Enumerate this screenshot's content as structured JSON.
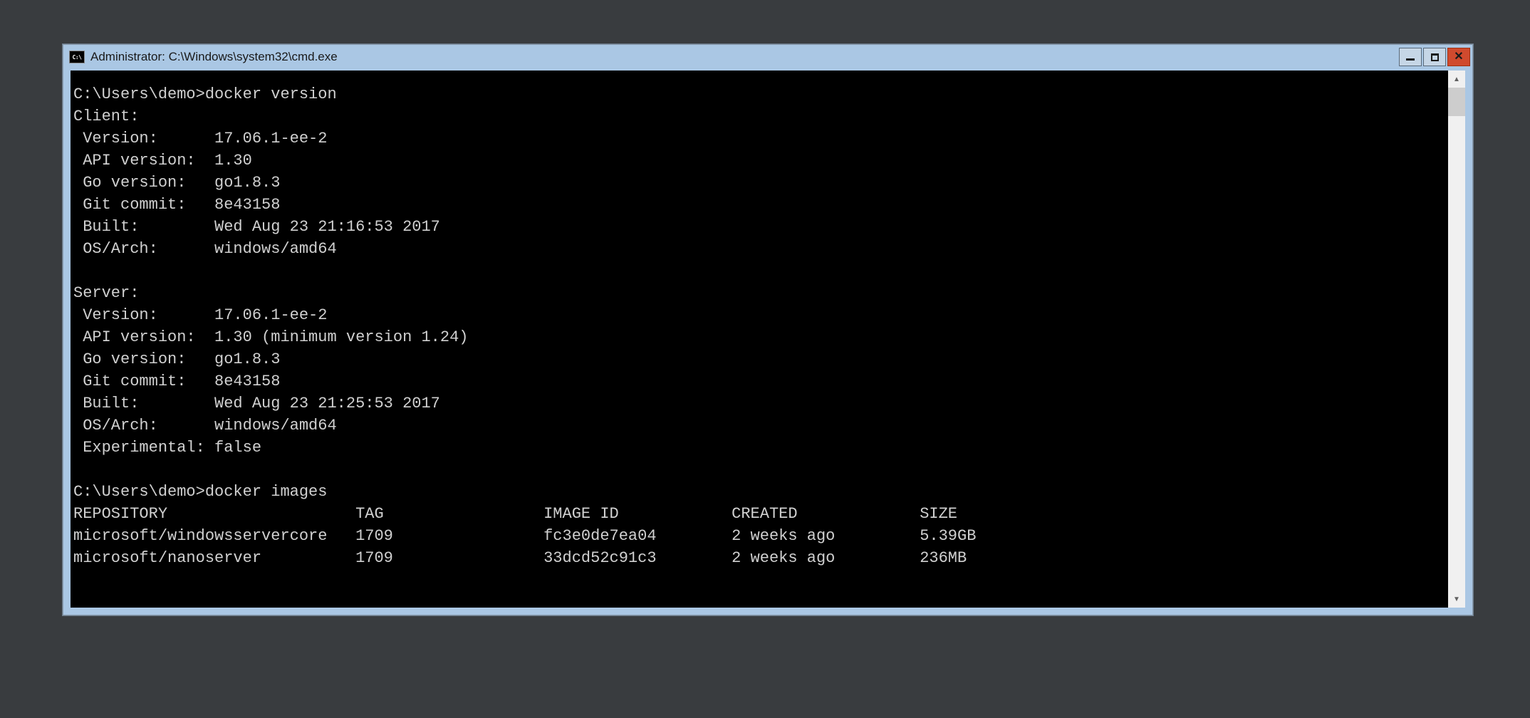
{
  "window": {
    "app_icon_label": "C:\\",
    "title": "Administrator: C:\\Windows\\system32\\cmd.exe"
  },
  "prompt1": "C:\\Users\\demo>",
  "command1": "docker version",
  "client_header": "Client:",
  "client": {
    "version_label": " Version:      ",
    "version_value": "17.06.1-ee-2",
    "api_label": " API version:  ",
    "api_value": "1.30",
    "go_label": " Go version:   ",
    "go_value": "go1.8.3",
    "git_label": " Git commit:   ",
    "git_value": "8e43158",
    "built_label": " Built:        ",
    "built_value": "Wed Aug 23 21:16:53 2017",
    "os_label": " OS/Arch:      ",
    "os_value": "windows/amd64"
  },
  "server_header": "Server:",
  "server": {
    "version_label": " Version:      ",
    "version_value": "17.06.1-ee-2",
    "api_label": " API version:  ",
    "api_value": "1.30 (minimum version 1.24)",
    "go_label": " Go version:   ",
    "go_value": "go1.8.3",
    "git_label": " Git commit:   ",
    "git_value": "8e43158",
    "built_label": " Built:        ",
    "built_value": "Wed Aug 23 21:25:53 2017",
    "os_label": " OS/Arch:      ",
    "os_value": "windows/amd64",
    "exp_label": " Experimental: ",
    "exp_value": "false"
  },
  "prompt2": "C:\\Users\\demo>",
  "command2": "docker images",
  "images_table": {
    "headers": {
      "repository": "REPOSITORY",
      "tag": "TAG",
      "image_id": "IMAGE ID",
      "created": "CREATED",
      "size": "SIZE"
    },
    "rows": [
      {
        "repository": "microsoft/windowsservercore",
        "tag": "1709",
        "image_id": "fc3e0de7ea04",
        "created": "2 weeks ago",
        "size": "5.39GB"
      },
      {
        "repository": "microsoft/nanoserver",
        "tag": "1709",
        "image_id": "33dcd52c91c3",
        "created": "2 weeks ago",
        "size": "236MB"
      }
    ]
  },
  "cols": {
    "repo": 30,
    "tag": 20,
    "id": 20,
    "created": 20
  }
}
